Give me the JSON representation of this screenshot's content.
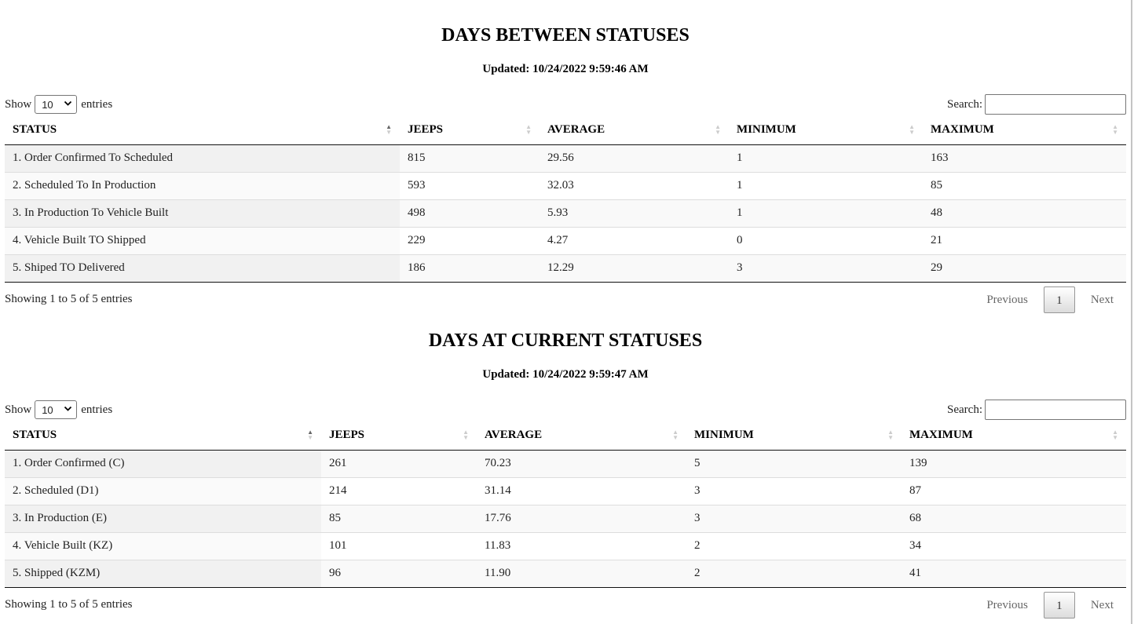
{
  "tables": [
    {
      "title": "DAYS BETWEEN STATUSES",
      "updated": "Updated: 10/24/2022 9:59:46 AM",
      "show_label": "Show",
      "entries_value": "10",
      "entries_label": "entries",
      "search_label": "Search:",
      "columns": [
        "STATUS",
        "JEEPS",
        "AVERAGE",
        "MINIMUM",
        "MAXIMUM"
      ],
      "rows": [
        [
          "1. Order Confirmed To Scheduled",
          "815",
          "29.56",
          "1",
          "163"
        ],
        [
          "2. Scheduled To In Production",
          "593",
          "32.03",
          "1",
          "85"
        ],
        [
          "3. In Production To Vehicle Built",
          "498",
          "5.93",
          "1",
          "48"
        ],
        [
          "4. Vehicle Built TO Shipped",
          "229",
          "4.27",
          "0",
          "21"
        ],
        [
          "5. Shiped TO Delivered",
          "186",
          "12.29",
          "3",
          "29"
        ]
      ],
      "info": "Showing 1 to 5 of 5 entries",
      "previous": "Previous",
      "page": "1",
      "next": "Next"
    },
    {
      "title": "DAYS AT CURRENT STATUSES",
      "updated": "Updated: 10/24/2022 9:59:47 AM",
      "show_label": "Show",
      "entries_value": "10",
      "entries_label": "entries",
      "search_label": "Search:",
      "columns": [
        "STATUS",
        "JEEPS",
        "AVERAGE",
        "MINIMUM",
        "MAXIMUM"
      ],
      "rows": [
        [
          "1. Order Confirmed (C)",
          "261",
          "70.23",
          "5",
          "139"
        ],
        [
          "2. Scheduled (D1)",
          "214",
          "31.14",
          "3",
          "87"
        ],
        [
          "3. In Production (E)",
          "85",
          "17.76",
          "3",
          "68"
        ],
        [
          "4. Vehicle Built (KZ)",
          "101",
          "11.83",
          "2",
          "34"
        ],
        [
          "5. Shipped (KZM)",
          "96",
          "11.90",
          "2",
          "41"
        ]
      ],
      "info": "Showing 1 to 5 of 5 entries",
      "previous": "Previous",
      "page": "1",
      "next": "Next"
    }
  ]
}
